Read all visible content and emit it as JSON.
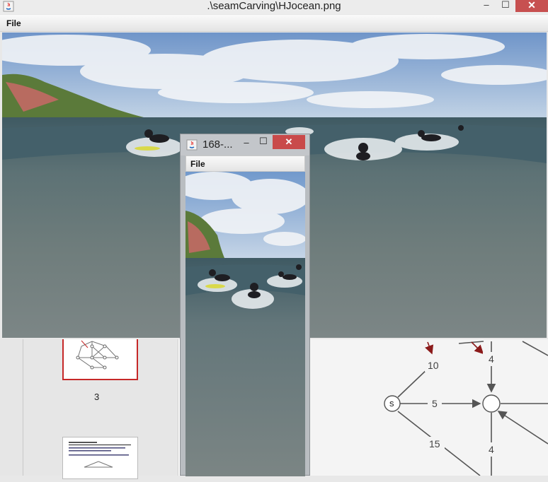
{
  "main_window": {
    "title": ".\\seamCarving\\HJocean.png",
    "menu": {
      "file_label": "File"
    },
    "controls": {
      "minimize": "–",
      "maximize": "☐",
      "close": "✕"
    }
  },
  "small_window": {
    "title": "168-...",
    "menu": {
      "file_label": "File"
    },
    "controls": {
      "minimize": "–",
      "maximize": "☐",
      "close": "✕"
    }
  },
  "background_app": {
    "slide_number": "3",
    "graph_labels": {
      "edge_top_left": "10",
      "edge_top_right": "4",
      "edge_middle": "5",
      "edge_bottom_left": "15",
      "edge_bottom_right": "4",
      "source_node": "s"
    }
  },
  "colors": {
    "close_button": "#c75050",
    "sky": "#8fb1d8",
    "ocean": "#546a70",
    "selected_slide_border": "#c62828"
  }
}
